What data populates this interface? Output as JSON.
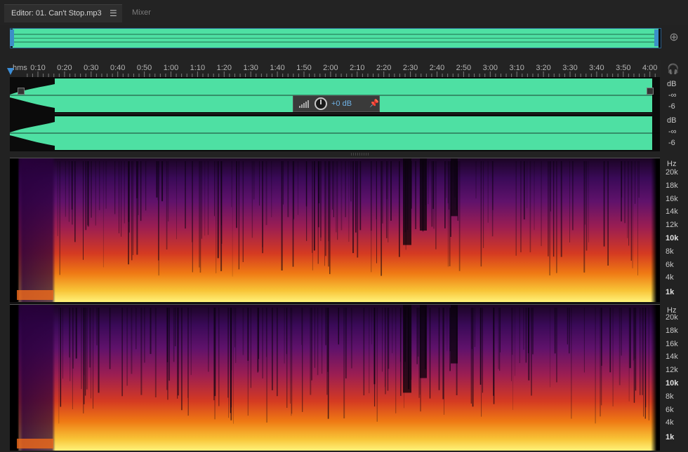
{
  "tabs": [
    {
      "label": "Editor: 01. Can't Stop.mp3",
      "active": true,
      "menu_icon": "hamburger-menu-icon"
    },
    {
      "label": "Mixer",
      "active": false
    }
  ],
  "toolbar": {
    "zoom_icon": "zoom-navigator-icon",
    "monitor_icon": "headphones-icon"
  },
  "ruler": {
    "unit": "hms",
    "ticks": [
      "0:10",
      "0:20",
      "0:30",
      "0:40",
      "0:50",
      "1:00",
      "1:10",
      "1:20",
      "1:30",
      "1:40",
      "1:50",
      "2:00",
      "2:10",
      "2:20",
      "2:30",
      "2:40",
      "2:50",
      "3:00",
      "3:10",
      "3:20",
      "3:30",
      "3:40",
      "3:50",
      "4:00"
    ]
  },
  "waveform": {
    "color": "#4ee0a3",
    "channel_scales": [
      {
        "unit": "dB",
        "marks": [
          "-∞",
          "-6"
        ]
      },
      {
        "unit": "dB",
        "marks": [
          "-∞",
          "-6"
        ]
      }
    ]
  },
  "hud": {
    "value": "+0 dB",
    "knob_icon": "volume-knob-icon",
    "pin_icon": "pin-icon",
    "meter_icon": "level-meter-icon"
  },
  "spectral": {
    "unit": "Hz",
    "labels": [
      "20k",
      "18k",
      "16k",
      "14k",
      "12k",
      "10k",
      "8k",
      "6k",
      "4k",
      "1k"
    ],
    "bold_labels": [
      "10k",
      "1k"
    ]
  }
}
